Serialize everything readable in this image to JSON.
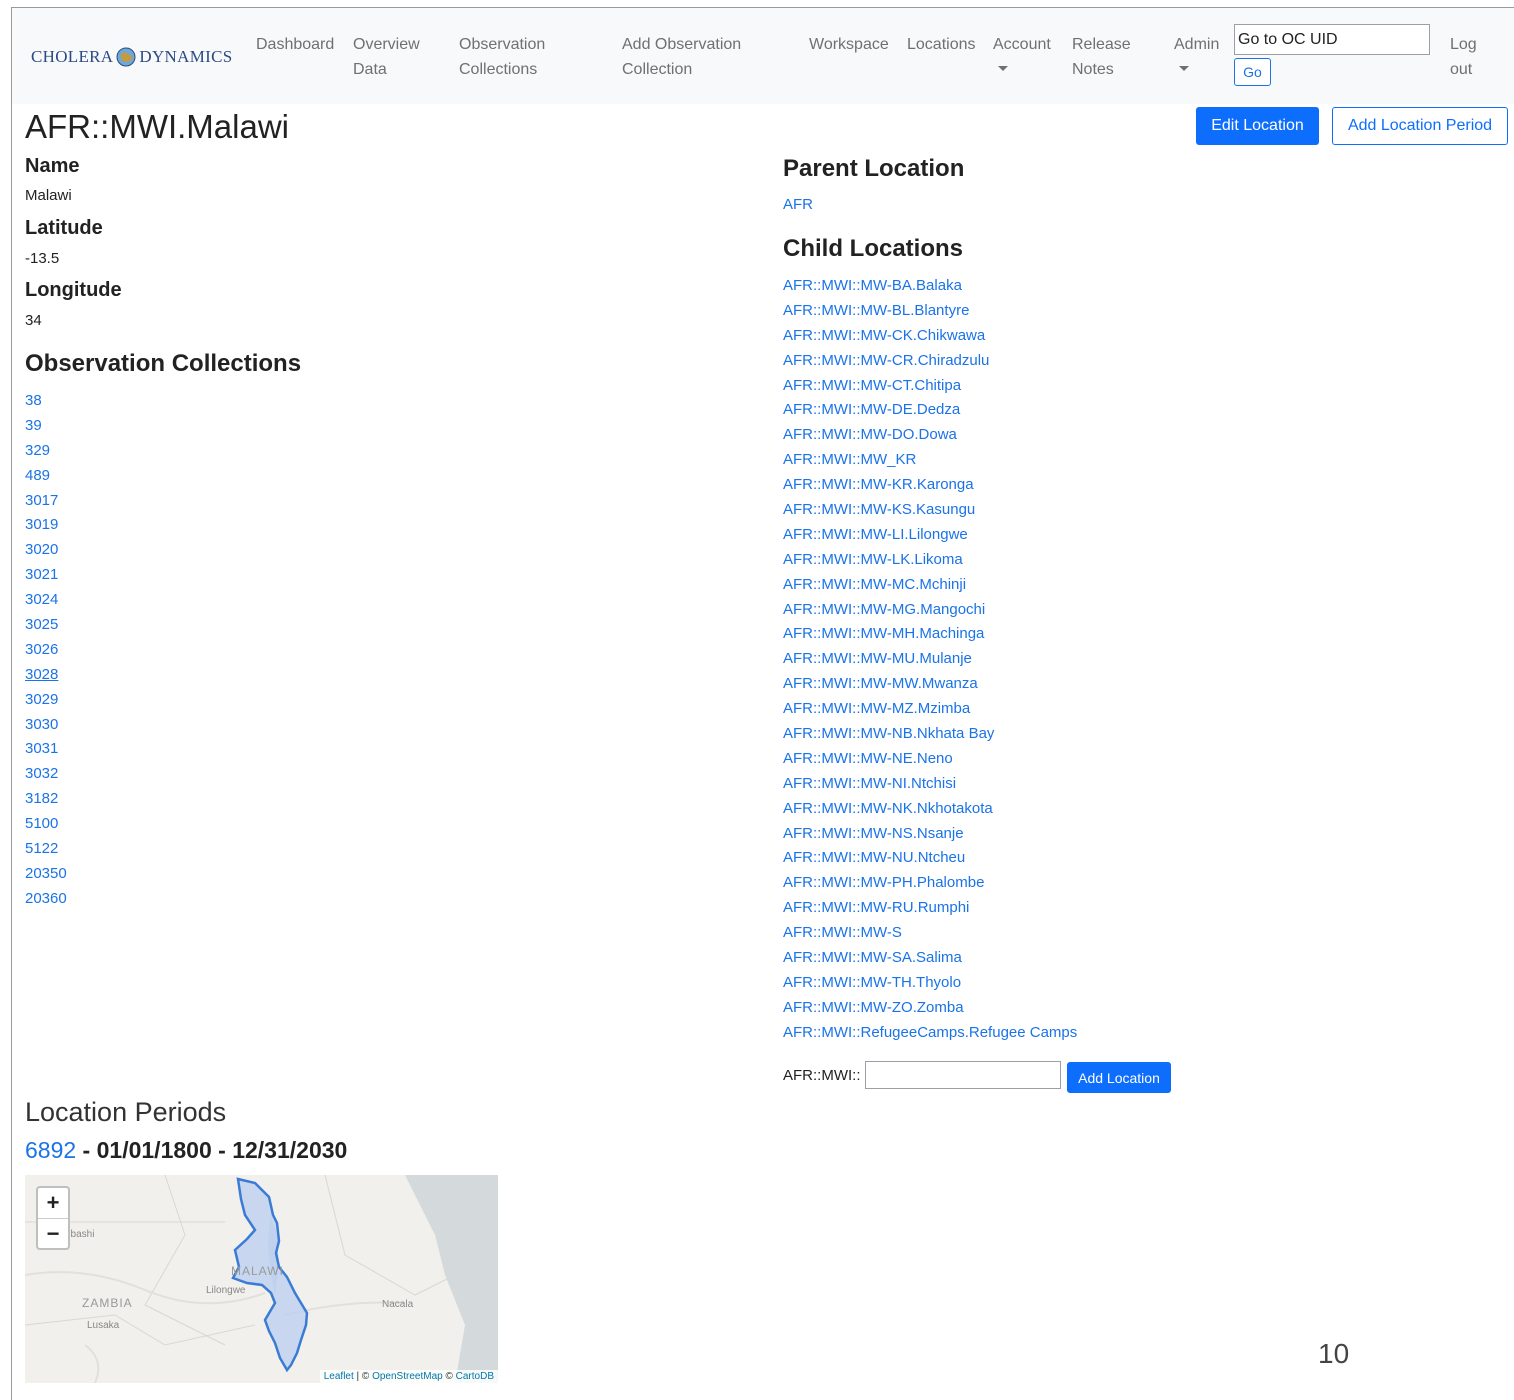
{
  "navbar": {
    "logo_left": "CHOLERA",
    "logo_right": "DYNAMICS",
    "dashboard": "Dashboard",
    "overview_1": "Overview",
    "overview_2": "Data",
    "obs_1": "Observation",
    "obs_2": "Collections",
    "addobs_1": "Add Observation",
    "addobs_2": "Collection",
    "workspace": "Workspace",
    "locations": "Locations",
    "account": "Account",
    "release_1": "Release",
    "release_2": "Notes",
    "admin": "Admin",
    "oc_value": "Go to OC UID",
    "go": "Go",
    "logout_1": "Log",
    "logout_2": "out"
  },
  "header": {
    "title": "AFR::MWI.Malawi",
    "edit_button": "Edit Location",
    "add_period_button": "Add Location Period"
  },
  "details": {
    "name_label": "Name",
    "name_value": "Malawi",
    "lat_label": "Latitude",
    "lat_value": "-13.5",
    "lon_label": "Longitude",
    "lon_value": "34"
  },
  "observation_collections": {
    "heading": "Observation Collections",
    "items": [
      "38",
      "39",
      "329",
      "489",
      "3017",
      "3019",
      "3020",
      "3021",
      "3024",
      "3025",
      "3026",
      "3028",
      "3029",
      "3030",
      "3031",
      "3032",
      "3182",
      "5100",
      "5122",
      "20350",
      "20360"
    ]
  },
  "parent": {
    "heading": "Parent Location",
    "link": "AFR"
  },
  "children": {
    "heading": "Child Locations",
    "items": [
      "AFR::MWI::MW-BA.Balaka",
      "AFR::MWI::MW-BL.Blantyre",
      "AFR::MWI::MW-CK.Chikwawa",
      "AFR::MWI::MW-CR.Chiradzulu",
      "AFR::MWI::MW-CT.Chitipa",
      "AFR::MWI::MW-DE.Dedza",
      "AFR::MWI::MW-DO.Dowa",
      "AFR::MWI::MW_KR",
      "AFR::MWI::MW-KR.Karonga",
      "AFR::MWI::MW-KS.Kasungu",
      "AFR::MWI::MW-LI.Lilongwe",
      "AFR::MWI::MW-LK.Likoma",
      "AFR::MWI::MW-MC.Mchinji",
      "AFR::MWI::MW-MG.Mangochi",
      "AFR::MWI::MW-MH.Machinga",
      "AFR::MWI::MW-MU.Mulanje",
      "AFR::MWI::MW-MW.Mwanza",
      "AFR::MWI::MW-MZ.Mzimba",
      "AFR::MWI::MW-NB.Nkhata Bay",
      "AFR::MWI::MW-NE.Neno",
      "AFR::MWI::MW-NI.Ntchisi",
      "AFR::MWI::MW-NK.Nkhotakota",
      "AFR::MWI::MW-NS.Nsanje",
      "AFR::MWI::MW-NU.Ntcheu",
      "AFR::MWI::MW-PH.Phalombe",
      "AFR::MWI::MW-RU.Rumphi",
      "AFR::MWI::MW-S",
      "AFR::MWI::MW-SA.Salima",
      "AFR::MWI::MW-TH.Thyolo",
      "AFR::MWI::MW-ZO.Zomba",
      "AFR::MWI::RefugeeCamps.Refugee Camps"
    ],
    "add_prefix": "AFR::MWI::",
    "add_value": "",
    "add_button": "Add Location"
  },
  "periods": {
    "heading": "Location Periods",
    "period_id": "6892",
    "sep1": " - ",
    "start": "01/01/1800",
    "sep2": " - ",
    "end": "12/31/2030"
  },
  "map": {
    "zoom_in": "+",
    "zoom_out": "−",
    "label_malawi": "MALAWI",
    "label_zambia": "ZAMBIA",
    "label_lilongwe": "Lilongwe",
    "label_lusaka": "Lusaka",
    "label_nacala": "Nacala",
    "label_lubumbashi": "nbashi",
    "attr_leaflet": "Leaflet",
    "attr_sep1": " | © ",
    "attr_osm": "OpenStreetMap",
    "attr_sep2": " © ",
    "attr_carto": "CartoDB",
    "outline_color": "#3a7bd5",
    "fill_color": "#b9cff0"
  },
  "page_number": "10"
}
